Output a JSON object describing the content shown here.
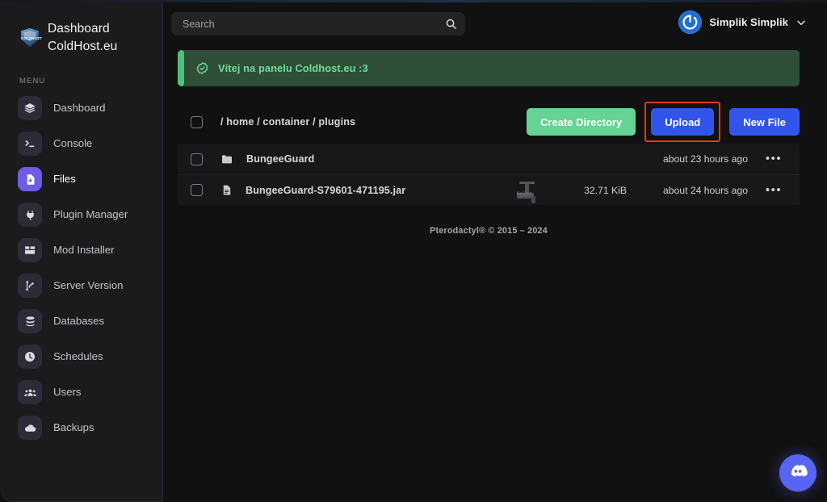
{
  "brand": {
    "logo_icon": "coldhost-shield-logo",
    "logo_word": "COLDHOST",
    "title_line1": "Dashboard",
    "title_line2": "ColdHost.eu"
  },
  "sidebar": {
    "section_label": "MENU",
    "items": [
      {
        "label": "Dashboard",
        "icon": "layers-icon",
        "active": false
      },
      {
        "label": "Console",
        "icon": "terminal-icon",
        "active": false
      },
      {
        "label": "Files",
        "icon": "file-download-icon",
        "active": true
      },
      {
        "label": "Plugin Manager",
        "icon": "plug-icon",
        "active": false
      },
      {
        "label": "Mod Installer",
        "icon": "box-icon",
        "active": false
      },
      {
        "label": "Server Version",
        "icon": "git-branch-icon",
        "active": false
      },
      {
        "label": "Databases",
        "icon": "database-icon",
        "active": false
      },
      {
        "label": "Schedules",
        "icon": "clock-icon",
        "active": false
      },
      {
        "label": "Users",
        "icon": "users-icon",
        "active": false
      },
      {
        "label": "Backups",
        "icon": "cloud-icon",
        "active": false
      }
    ]
  },
  "topbar": {
    "search": {
      "placeholder": "Search",
      "value": "",
      "icon": "search-icon"
    },
    "user": {
      "name": "Simplik Simplik",
      "avatar_icon": "power-circle-avatar",
      "chevron_icon": "chevron-down-icon"
    }
  },
  "alert": {
    "icon": "check-badge-icon",
    "message": "Vítej na panelu Coldhost.eu :3",
    "accent_color": "#4ec27a",
    "background_color": "#2f4e38",
    "text_color": "#6ede97"
  },
  "toolbar": {
    "select_all_checkbox": "unchecked",
    "breadcrumb": "/ home / container / plugins",
    "create_directory_label": "Create Directory",
    "upload_label": "Upload",
    "new_file_label": "New File",
    "highlight_target": "Upload",
    "highlight_color": "#e8361c",
    "green_button_color": "#64d394",
    "blue_button_color": "#3155ea"
  },
  "files": {
    "rows": [
      {
        "checkbox": "unchecked",
        "icon": "folder-icon",
        "name": "BungeeGuard",
        "size": "",
        "modified": "about 23 hours ago",
        "menu": "•••"
      },
      {
        "checkbox": "unchecked",
        "icon": "file-icon",
        "name": "BungeeGuard-S79601-471195.jar",
        "size": "32.71 KiB",
        "modified": "about 24 hours ago",
        "menu": "•••"
      }
    ]
  },
  "cursor": {
    "icon": "faucet-spigot-cursor",
    "label": "Spigot"
  },
  "footer": {
    "text": "Pterodactyl® © 2015 – 2024"
  },
  "fab": {
    "icon": "discord-icon",
    "color": "#5865f2"
  }
}
